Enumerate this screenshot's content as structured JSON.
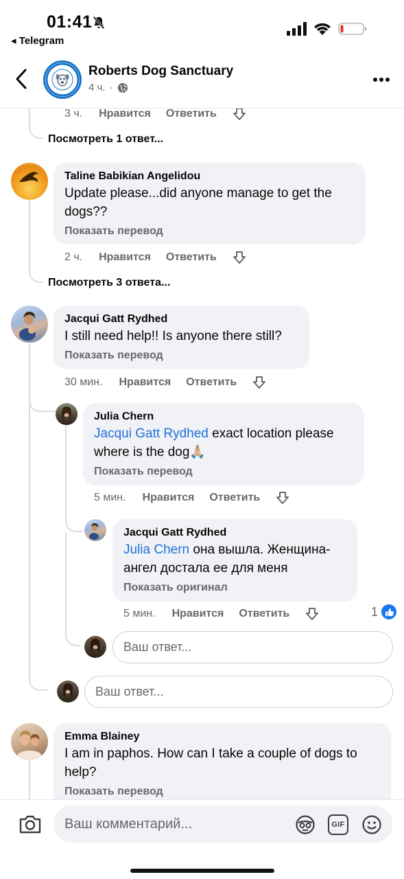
{
  "status_bar": {
    "time": "01:41",
    "back_app": "◂ Telegram"
  },
  "header": {
    "page_name": "Roberts Dog Sanctuary",
    "post_time": "4 ч.",
    "separator": "·"
  },
  "thread": {
    "top_actions": {
      "time": "3 ч.",
      "like": "Нравится",
      "reply": "Ответить"
    },
    "top_view_replies": "Посмотреть 1 ответ...",
    "comments": [
      {
        "author": "Taline Babikian Angelidou",
        "text": "Update please...did anyone manage to get the dogs??",
        "translate": "Показать перевод",
        "time": "2 ч.",
        "like": "Нравится",
        "reply": "Ответить",
        "view_replies": "Посмотреть 3 ответа..."
      },
      {
        "author": "Jacqui Gatt Rydhed",
        "text": "I still need help!! Is anyone there still?",
        "translate": "Показать перевод",
        "time": "30 мин.",
        "like": "Нравится",
        "reply": "Ответить",
        "replies": [
          {
            "author": "Julia Chern",
            "mention": "Jacqui Gatt Rydhed",
            "text": " exact location please where is the dog🙏🏼",
            "translate": "Показать перевод",
            "time": "5 мин.",
            "like": "Нравится",
            "reply": "Ответить"
          },
          {
            "author": "Jacqui Gatt Rydhed",
            "mention": "Julia Chern",
            "text": " она вышла. Женщина-ангел достала ее для меня",
            "translate": "Показать оригинал",
            "time": "5 мин.",
            "like": "Нравится",
            "reply": "Ответить",
            "like_count": "1"
          }
        ],
        "nested_reply_placeholder": "Ваш ответ...",
        "reply_placeholder": "Ваш ответ..."
      },
      {
        "author": "Emma Blainey",
        "text": "I am in paphos. How can I take a couple of dogs to help?",
        "translate": "Показать перевод"
      }
    ]
  },
  "composer": {
    "placeholder": "Ваш комментарий...",
    "gif_label": "GIF"
  },
  "colors": {
    "mention": "#216fdb",
    "like_badge": "#1877f2",
    "bubble": "#f0f2f5",
    "battery_low": "#e0312b"
  },
  "icons": [
    "bell-off-icon",
    "signal-icon",
    "wifi-icon",
    "battery-icon",
    "back-chevron-icon",
    "globe-icon",
    "more-icon",
    "downvote-icon",
    "thumbs-up-icon",
    "camera-icon",
    "avatar-sticker-icon",
    "gif-icon",
    "emoji-icon"
  ]
}
